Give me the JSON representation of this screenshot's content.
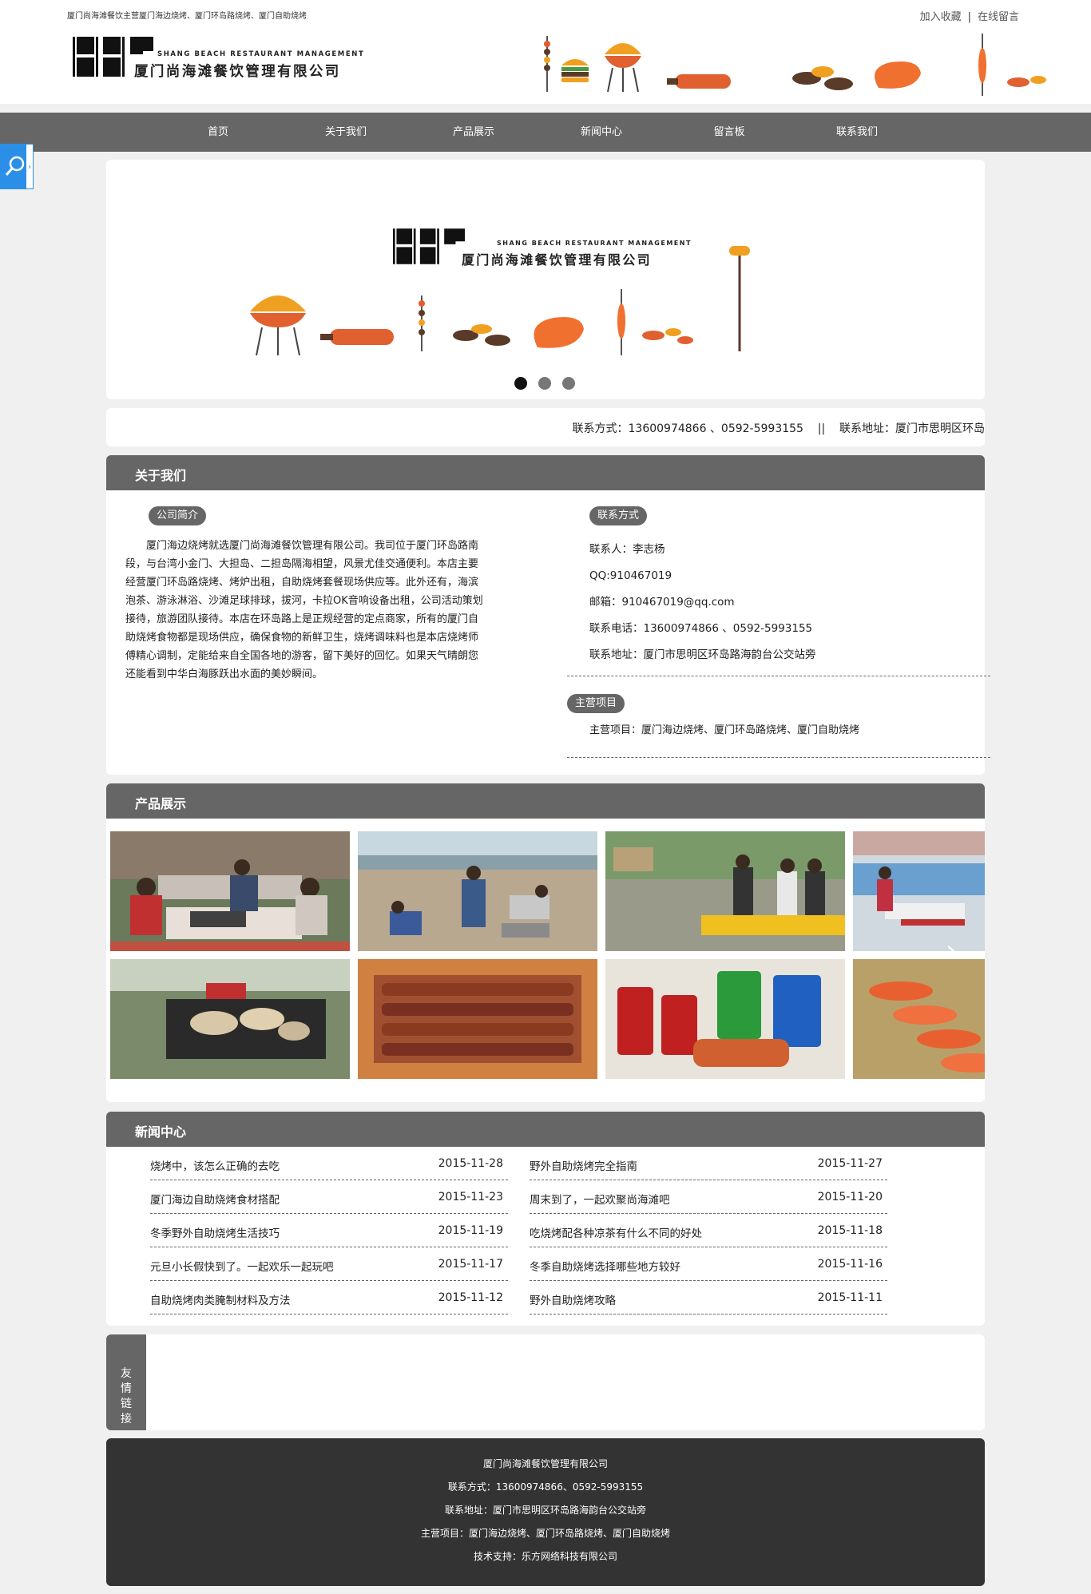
{
  "top": {
    "tagline": "厦门尚海滩餐饮主营厦门海边烧烤、厦门环岛路烧烤、厦门自助烧烤",
    "links": [
      "加入收藏",
      "在线留言"
    ],
    "separator": "|"
  },
  "logo": {
    "en": "SHANG BEACH RESTAURANT MANAGEMENT",
    "cn": "厦门尚海滩餐饮管理有限公司"
  },
  "nav": [
    "首页",
    "关于我们",
    "产品展示",
    "新闻中心",
    "留言板",
    "联系我们"
  ],
  "float_search": {
    "icon": "search-icon",
    "tab": "›"
  },
  "banner": {
    "logo_en": "SHANG BEACH RESTAURANT MANAGEMENT",
    "logo_cn": "厦门尚海滩餐饮管理有限公司",
    "dots": 3,
    "active_dot": 1
  },
  "contact_bar": "联系方式：13600974866 、0592-5993155    ||    联系地址：厦门市思明区环岛",
  "about": {
    "heading": "关于我们",
    "intro_label": "公司简介",
    "intro_text": "厦门海边烧烤就选厦门尚海滩餐饮管理有限公司。我司位于厦门环岛路南段，与台湾小金门、大担岛、二担岛隔海相望，风景尤佳交通便利。本店主要经营厦门环岛路烧烤、烤炉出租，自助烧烤套餐现场供应等。此外还有，海滨泡茶、游泳淋浴、沙滩足球排球，拔河，卡拉OK音响设备出租，公司活动策划接待，旅游团队接待。本店在环岛路上是正规经营的定点商家，所有的厦门自助烧烤食物都是现场供应，确保食物的新鲜卫生，烧烤调味料也是本店烧烤师傅精心调制，定能给来自全国各地的游客，留下美好的回忆。如果天气晴朗您还能看到中华白海豚跃出水面的美妙瞬间。",
    "contact_label": "联系方式",
    "contact": [
      "联系人：李志杨",
      "QQ:910467019",
      "邮箱：910467019@qq.com",
      "联系电话：13600974866 、0592-5993155",
      "联系地址：厦门市思明区环岛路海韵台公交站旁"
    ],
    "business_label": "主营项目",
    "business": "主营项目：厦门海边烧烤、厦门环岛路烧烤、厦门自助烧烤"
  },
  "products": {
    "heading": "产品展示",
    "arrow": "›"
  },
  "news": {
    "heading": "新闻中心",
    "left": [
      {
        "title": "烧烤中，该怎么正确的去吃",
        "date": "2015-11-28"
      },
      {
        "title": "厦门海边自助烧烤食材搭配",
        "date": "2015-11-23"
      },
      {
        "title": "冬季野外自助烧烤生活技巧",
        "date": "2015-11-19"
      },
      {
        "title": "元旦小长假快到了。一起欢乐一起玩吧",
        "date": "2015-11-17"
      },
      {
        "title": "自助烧烤肉类腌制材料及方法",
        "date": "2015-11-12"
      }
    ],
    "right": [
      {
        "title": "野外自助烧烤完全指南",
        "date": "2015-11-27"
      },
      {
        "title": "周末到了，一起欢聚尚海滩吧",
        "date": "2015-11-20"
      },
      {
        "title": "吃烧烤配各种凉茶有什么不同的好处",
        "date": "2015-11-18"
      },
      {
        "title": "冬季自助烧烤选择哪些地方较好",
        "date": "2015-11-16"
      },
      {
        "title": "野外自助烧烤攻略",
        "date": "2015-11-11"
      }
    ]
  },
  "friends": {
    "label": [
      "友",
      "情",
      "链",
      "接"
    ]
  },
  "footer": [
    "厦门尚海滩餐饮管理有限公司",
    "联系方式：13600974866、0592-5993155",
    "联系地址：厦门市思明区环岛路海韵台公交站旁",
    "主营项目：厦门海边烧烤、厦门环岛路烧烤、厦门自助烧烤",
    "技术支持：乐方网络科技有限公司"
  ],
  "colors": {
    "nav": "#666666",
    "footer": "#333333",
    "search": "#2b8fe8",
    "accent": "#f0a020"
  }
}
